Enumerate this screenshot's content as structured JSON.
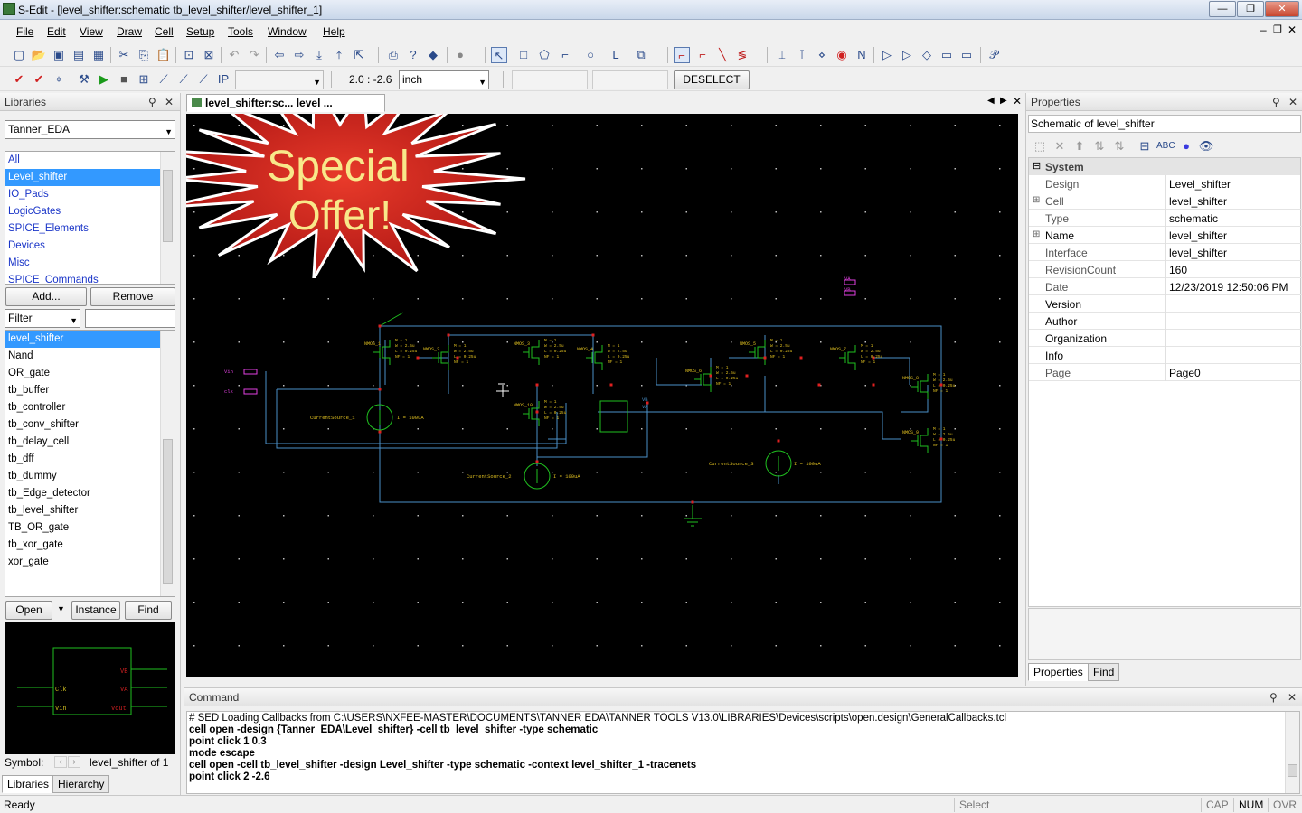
{
  "window": {
    "title": "S-Edit - [level_shifter:schematic tb_level_shifter/level_shifter_1]",
    "min": "—",
    "max": "❐",
    "close": "✕"
  },
  "menu": [
    "File",
    "Edit",
    "View",
    "Draw",
    "Cell",
    "Setup",
    "Tools",
    "Window",
    "Help"
  ],
  "toolbar2": {
    "coords": "2.0 : -2.6",
    "unit": "inch",
    "deselect": "DESELECT"
  },
  "libraries": {
    "title": "Libraries",
    "library": "Tanner_EDA",
    "items": [
      "All",
      "Level_shifter",
      "IO_Pads",
      "LogicGates",
      "SPICE_Elements",
      "Devices",
      "Misc",
      "SPICE_Commands"
    ],
    "selected": "Level_shifter",
    "add": "Add...",
    "remove": "Remove",
    "filter": "Filter",
    "cells": [
      "level_shifter",
      "Nand",
      "OR_gate",
      "tb_buffer",
      "tb_controller",
      "tb_conv_shifter",
      "tb_delay_cell",
      "tb_dff",
      "tb_dummy",
      "tb_Edge_detector",
      "tb_level_shifter",
      "TB_OR_gate",
      "tb_xor_gate",
      "xor_gate"
    ],
    "open": "Open",
    "instance": "Instance",
    "find": "Find",
    "symbol_label": "Symbol:",
    "symbol_value": "level_shifter of 1",
    "tab_libraries": "Libraries",
    "tab_hierarchy": "Hierarchy",
    "preview": {
      "pins_left": [
        "Clk",
        "Vin"
      ],
      "pins_right": [
        "VB",
        "VA",
        "Vout"
      ]
    }
  },
  "doc_tab": "level_shifter:sc... level ...",
  "promo": {
    "line1": "Special",
    "line2": "Offer!"
  },
  "schematic": {
    "vin": "Vin",
    "clk": "clk",
    "cs1": "CurrentSource_1",
    "cs2": "CurrentSource_2",
    "cs3": "CurrentSource_3",
    "i": "I = 100uA",
    "va": "VA",
    "vb": "VB",
    "nmos": [
      "NMOS_1",
      "NMOS_2",
      "NMOS_3",
      "NMOS_4",
      "NMOS_5",
      "NMOS_6",
      "NMOS_7",
      "NMOS_8",
      "NMOS_9",
      "NMOS_10"
    ],
    "params": [
      "M = 1",
      "W = 2.5u",
      "L = 0.25u",
      "NF = 1"
    ]
  },
  "properties": {
    "title": "Properties",
    "heading": "Schematic of level_shifter",
    "group": "System",
    "rows": [
      {
        "k": "Design",
        "v": "Level_shifter",
        "ro": true
      },
      {
        "k": "Cell",
        "v": "level_shifter",
        "ro": true,
        "exp": true
      },
      {
        "k": "Type",
        "v": "schematic",
        "ro": true
      },
      {
        "k": "Name",
        "v": "level_shifter",
        "ro": false,
        "exp": true
      },
      {
        "k": "Interface",
        "v": "level_shifter",
        "ro": true
      },
      {
        "k": "RevisionCount",
        "v": "160",
        "ro": true
      },
      {
        "k": "Date",
        "v": "12/23/2019 12:50:06 PM",
        "ro": true
      },
      {
        "k": "Version",
        "v": "",
        "ro": false
      },
      {
        "k": "Author",
        "v": "",
        "ro": false
      },
      {
        "k": "Organization",
        "v": "",
        "ro": false
      },
      {
        "k": "Info",
        "v": "",
        "ro": false
      },
      {
        "k": "Page",
        "v": "Page0",
        "ro": true
      }
    ],
    "tab_properties": "Properties",
    "tab_find": "Find"
  },
  "command": {
    "title": "Command",
    "lines": [
      {
        "t": "# SED  Loading Callbacks from C:\\USERS\\NXFEE-MASTER\\DOCUMENTS\\TANNER EDA\\TANNER TOOLS V13.0\\LIBRARIES\\Devices\\scripts\\open.design\\GeneralCallbacks.tcl",
        "b": false
      },
      {
        "t": "cell open -design {Tanner_EDA\\Level_shifter} -cell tb_level_shifter -type schematic",
        "b": true
      },
      {
        "t": "point click 1 0.3",
        "b": true
      },
      {
        "t": "mode escape",
        "b": true
      },
      {
        "t": "cell open -cell tb_level_shifter -design Level_shifter -type schematic -context level_shifter_1 -tracenets",
        "b": true
      },
      {
        "t": "point click 2 -2.6",
        "b": true
      }
    ]
  },
  "status": {
    "ready": "Ready",
    "select": "Select",
    "cap": "CAP",
    "num": "NUM",
    "ovr": "OVR"
  }
}
